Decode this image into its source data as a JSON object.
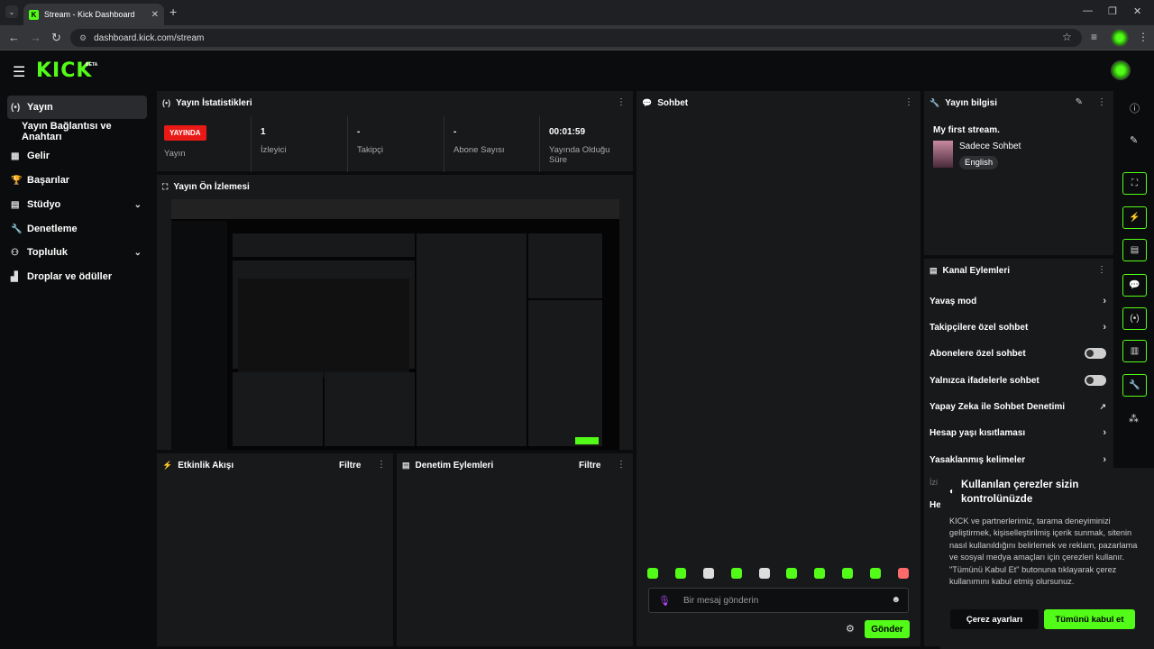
{
  "browser": {
    "tab_title": "Stream - Kick Dashboard",
    "url": "dashboard.kick.com/stream"
  },
  "app": {
    "logo": "KICK",
    "beta": "BETA"
  },
  "sidebar": {
    "items": [
      {
        "label": "Yayın",
        "icon": "broadcast-icon"
      },
      {
        "label": "Yayın Bağlantısı ve Anahtarı"
      },
      {
        "label": "Gelir",
        "icon": "chart-icon"
      },
      {
        "label": "Başarılar",
        "icon": "trophy-icon"
      },
      {
        "label": "Stüdyo",
        "icon": "studio-icon"
      },
      {
        "label": "Denetleme",
        "icon": "wrench-icon"
      },
      {
        "label": "Topluluk",
        "icon": "community-icon"
      },
      {
        "label": "Droplar ve ödüller",
        "icon": "drops-icon"
      }
    ]
  },
  "stats": {
    "title": "Yayın İstatistikleri",
    "live_badge": "YAYINDA",
    "live_label": "Yayın",
    "items": [
      {
        "value": "1",
        "label": "İzleyici"
      },
      {
        "value": "-",
        "label": "Takipçi"
      },
      {
        "value": "-",
        "label": "Abone Sayısı"
      },
      {
        "value": "00:01:59",
        "label": "Yayında Olduğu Süre"
      }
    ]
  },
  "preview": {
    "title": "Yayın Ön İzlemesi"
  },
  "activity": {
    "title": "Etkinlik Akışı",
    "filter": "Filtre"
  },
  "moderation": {
    "title": "Denetim Eylemleri",
    "filter": "Filtre"
  },
  "chat": {
    "title": "Sohbet",
    "placeholder": "Bir mesaj gönderin",
    "send": "Gönder"
  },
  "stream_info": {
    "title": "Yayın bilgisi",
    "stream_title": "My first stream.",
    "category": "Sadece Sohbet",
    "language": "English"
  },
  "channel_actions": {
    "title": "Kanal Eylemleri",
    "rows": [
      {
        "label": "Yavaş mod",
        "control": "chevron"
      },
      {
        "label": "Takipçilere özel sohbet",
        "control": "chevron"
      },
      {
        "label": "Abonelere özel sohbet",
        "control": "toggle"
      },
      {
        "label": "Yalnızca ifadelerle sohbet",
        "control": "toggle"
      },
      {
        "label": "Yapay Zeka ile Sohbet Denetimi",
        "control": "external"
      },
      {
        "label": "Hesap yaşı kısıtlaması",
        "control": "chevron"
      },
      {
        "label": "Yasaklanmış kelimeler",
        "control": "chevron"
      }
    ],
    "partial1": "İzi",
    "partial2": "He"
  },
  "cookie": {
    "title": "Kullanılan çerezler sizin kontrolünüzde",
    "body": "KICK ve partnerlerimiz, tarama deneyiminizi geliştirmek, kişiselleştirilmiş içerik sunmak, sitenin nasıl kullanıldığını belirlemek ve reklam, pazarlama ve sosyal medya amaçları için çerezleri kullanır. \"Tümünü Kabul Et\" butonuna tıklayarak çerez kullanımını kabul etmiş olursunuz.",
    "settings": "Çerez ayarları",
    "accept": "Tümünü kabul et"
  },
  "colors": {
    "accent": "#53fc18",
    "live": "#e91916"
  }
}
